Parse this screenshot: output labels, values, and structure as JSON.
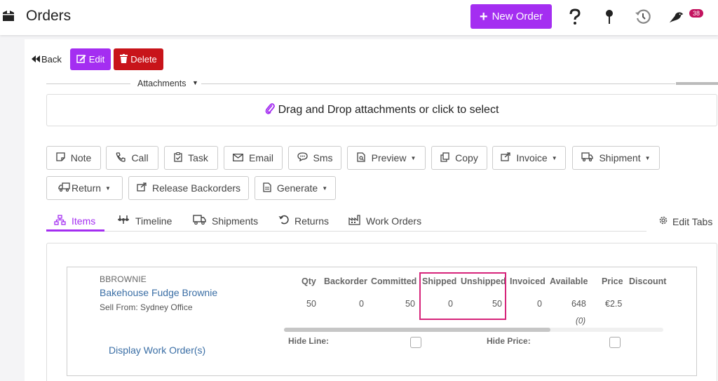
{
  "header": {
    "title": "Orders",
    "new_order_label": "New Order",
    "notification_count": "38"
  },
  "toolbar": {
    "back_label": "Back",
    "edit_label": "Edit",
    "delete_label": "Delete"
  },
  "attachments": {
    "label": "Attachments",
    "dropzone_text": "Drag and Drop attachments or click to select"
  },
  "actions": {
    "row1": [
      "Note",
      "Call",
      "Task",
      "Email",
      "Sms",
      "Preview",
      "Copy",
      "Invoice",
      "Shipment"
    ],
    "row2": [
      "Return",
      "Release Backorders",
      "Generate"
    ]
  },
  "tabs": [
    "Items",
    "Timeline",
    "Shipments",
    "Returns",
    "Work Orders"
  ],
  "edit_tabs_label": "Edit Tabs",
  "line_item": {
    "sku": "BBROWNIE",
    "name": "Bakehouse Fudge Brownie",
    "sell_from": "Sell From: Sydney Office",
    "columns": [
      "Qty",
      "Backorder",
      "Committed",
      "Shipped",
      "Unshipped",
      "Invoiced",
      "Available",
      "Price",
      "Discount"
    ],
    "values": [
      "50",
      "0",
      "50",
      "0",
      "50",
      "0",
      "648",
      "€2.5",
      ""
    ],
    "available_sub": "(0)",
    "hide_line_label": "Hide Line:",
    "hide_price_label": "Hide Price:",
    "work_orders_link": "Display Work Order(s)"
  },
  "colors": {
    "accent": "#a42ef1",
    "danger": "#c8141a",
    "highlight": "#d6247a",
    "link": "#3a6ea5"
  }
}
